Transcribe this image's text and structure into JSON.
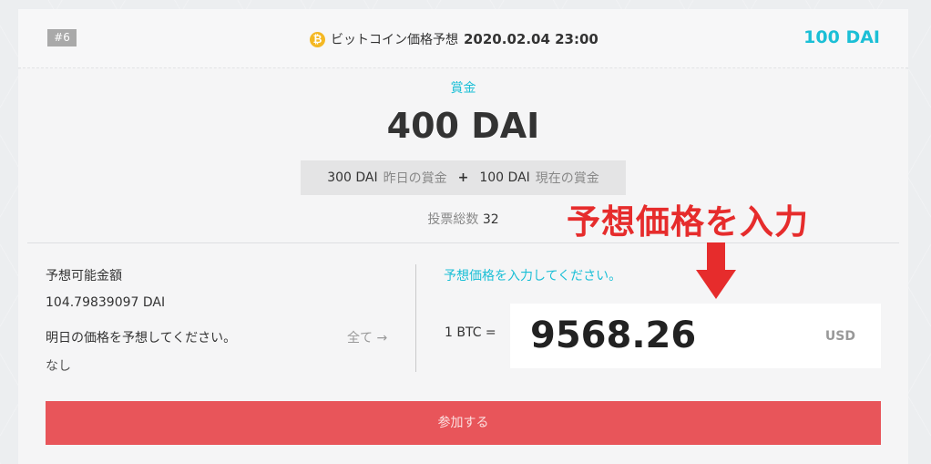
{
  "header": {
    "badge": "#6",
    "title": "ビットコイン価格予想",
    "datetime": "2020.02.04 23:00",
    "amount": "100 DAI",
    "coin_symbol": "₿"
  },
  "prize": {
    "label": "賞金",
    "value": "400 DAI",
    "yesterday_amount": "300 DAI",
    "yesterday_label": "昨日の賞金",
    "plus": "+",
    "current_amount": "100 DAI",
    "current_label": "現在の賞金",
    "votes_label": "投票総数",
    "votes_count": "32"
  },
  "left": {
    "available_label": "予想可能金額",
    "available_value": "104.79839097 DAI",
    "tomorrow_label": "明日の価格を予想してください。",
    "tomorrow_value": "なし",
    "all_link": "全て →"
  },
  "right": {
    "prompt": "予想価格を入力してください。",
    "btc_label": "1 BTC =",
    "input_value": "9568.26",
    "unit": "USD"
  },
  "join_button": "参加する",
  "annotation": "予想価格を入力",
  "colors": {
    "accent": "#1bbfd6",
    "button": "#e8555a",
    "annotation": "#e62c2c",
    "coin": "#f4b824"
  }
}
